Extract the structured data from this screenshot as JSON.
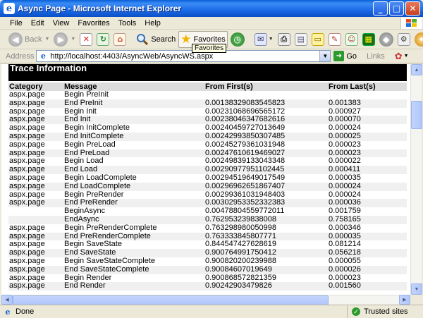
{
  "window": {
    "title": "Async Page - Microsoft Internet Explorer"
  },
  "menu": [
    "File",
    "Edit",
    "View",
    "Favorites",
    "Tools",
    "Help"
  ],
  "toolbar": {
    "back_label": "Back",
    "search_label": "Search",
    "favorites_label": "Favorites",
    "tooltip": "Favorites"
  },
  "address": {
    "label": "Address",
    "url": "http://localhost:4403/AsyncWeb/AsyncWS.aspx",
    "go_label": "Go",
    "links_label": "Links"
  },
  "trace": {
    "title": "Trace Information",
    "headers": [
      "Category",
      "Message",
      "From First(s)",
      "From Last(s)"
    ],
    "rows": [
      [
        "aspx.page",
        "Begin PreInit",
        "",
        ""
      ],
      [
        "aspx.page",
        "End PreInit",
        "0.00138329083545823",
        "0.001383"
      ],
      [
        "aspx.page",
        "Begin Init",
        "0.00231068696565172",
        "0.000927"
      ],
      [
        "aspx.page",
        "End Init",
        "0.00238046347682616",
        "0.000070"
      ],
      [
        "aspx.page",
        "Begin InitComplete",
        "0.00240459727013649",
        "0.000024"
      ],
      [
        "aspx.page",
        "End InitComplete",
        "0.00242993850307485",
        "0.000025"
      ],
      [
        "aspx.page",
        "Begin PreLoad",
        "0.00245279361031948",
        "0.000023"
      ],
      [
        "aspx.page",
        "End PreLoad",
        "0.00247610619469027",
        "0.000023"
      ],
      [
        "aspx.page",
        "Begin Load",
        "0.00249839133043348",
        "0.000022"
      ],
      [
        "aspx.page",
        "End Load",
        "0.00290977951102445",
        "0.000411"
      ],
      [
        "aspx.page",
        "Begin LoadComplete",
        "0.00294519649017549",
        "0.000035"
      ],
      [
        "aspx.page",
        "End LoadComplete",
        "0.00296962651867407",
        "0.000024"
      ],
      [
        "aspx.page",
        "Begin PreRender",
        "0.00299361031948403",
        "0.000024"
      ],
      [
        "aspx.page",
        "End PreRender",
        "0.00302953352332383",
        "0.000036"
      ],
      [
        "",
        "BeginAsync",
        "0.00478804559772011",
        "0.001759"
      ],
      [
        "",
        "EndAsync",
        "0.762953239838008",
        "0.758165"
      ],
      [
        "aspx.page",
        "Begin PreRenderComplete",
        "0.763298980050998",
        "0.000346"
      ],
      [
        "aspx.page",
        "End PreRenderComplete",
        "0.763333845807771",
        "0.000035"
      ],
      [
        "aspx.page",
        "Begin SaveState",
        "0.844547427628619",
        "0.081214"
      ],
      [
        "aspx.page",
        "End SaveState",
        "0.900764991750412",
        "0.056218"
      ],
      [
        "aspx.page",
        "Begin SaveStateComplete",
        "0.900820200239988",
        "0.000055"
      ],
      [
        "aspx.page",
        "End SaveStateComplete",
        "0.90084607019649",
        "0.000026"
      ],
      [
        "aspx.page",
        "Begin Render",
        "0.900868572821359",
        "0.000023"
      ],
      [
        "aspx.page",
        "End Render",
        "0.90242903479826",
        "0.001560"
      ]
    ]
  },
  "status": {
    "text": "Done",
    "zone": "Trusted sites"
  }
}
